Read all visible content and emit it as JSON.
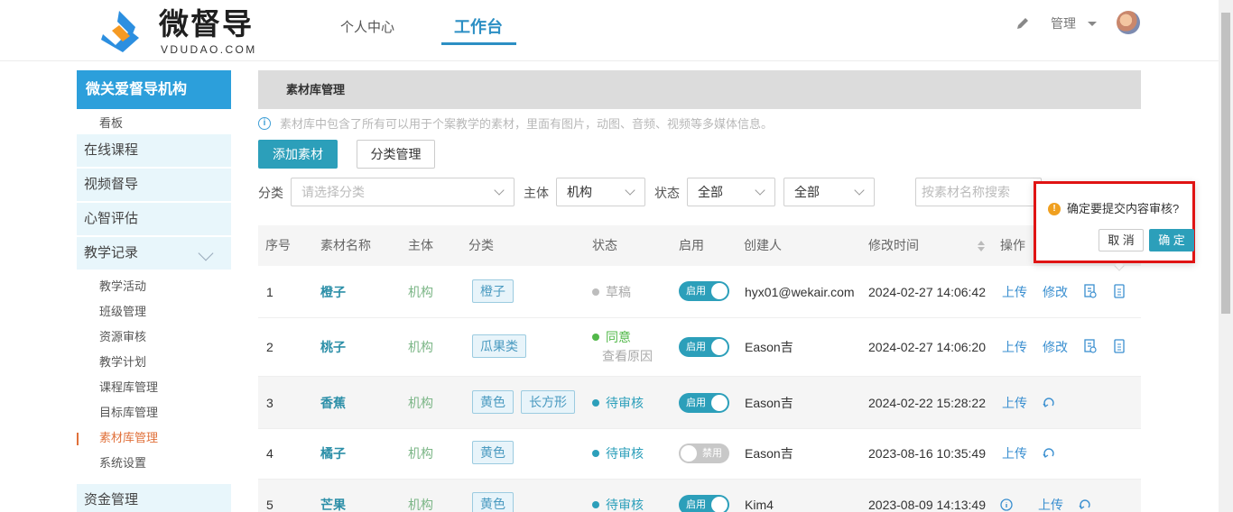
{
  "brand": {
    "name": "微督导",
    "sub": "VDUDAO.COM",
    "mark_color": "#2c8fe0",
    "accent_color": "#f59a23"
  },
  "nav": {
    "items": [
      "个人中心",
      "工作台"
    ],
    "active": "工作台"
  },
  "user": {
    "label": "管理",
    "edit_icon": "pencil-icon",
    "avatar": "avatar-image"
  },
  "sidebar": {
    "org": "微关爱督导机构",
    "kanban": "看板",
    "groups": [
      "在线课程",
      "视频督导",
      "心智评估",
      "教学记录",
      "资金管理"
    ],
    "sub_items": [
      "教学活动",
      "班级管理",
      "资源审核",
      "教学计划",
      "课程库管理",
      "目标库管理",
      "素材库管理",
      "系统设置"
    ],
    "active_item": "素材库管理"
  },
  "page": {
    "title": "素材库管理",
    "info": "素材库中包含了所有可以用于个案教学的素材，里面有图片，动图、音频、视频等多媒体信息。",
    "add_button": "添加素材",
    "category_button": "分类管理"
  },
  "filters": {
    "category_label": "分类",
    "category_placeholder": "请选择分类",
    "subject_label": "主体",
    "subject_value": "机构",
    "status_label": "状态",
    "status_value": "全部",
    "enabled_value": "全部",
    "search_placeholder": "按素材名称搜索"
  },
  "table": {
    "columns": [
      "序号",
      "素材名称",
      "主体",
      "分类",
      "状态",
      "启用",
      "创建人",
      "修改时间",
      "操作"
    ],
    "rows": [
      {
        "no": "1",
        "name": "橙子",
        "subject": "机构",
        "tags": [
          "橙子"
        ],
        "status": "草稿",
        "status_color": "#bdbdbd",
        "status_note": "",
        "enabled": "启用",
        "creator": "hyx01@wekair.com",
        "modified": "2024-02-27 14:06:42",
        "ops": [
          "上传",
          "修改"
        ]
      },
      {
        "no": "2",
        "name": "桃子",
        "subject": "机构",
        "tags": [
          "瓜果类"
        ],
        "status": "同意",
        "status_color": "#52b84a",
        "status_note": "查看原因",
        "enabled": "启用",
        "creator": "Eason吉",
        "modified": "2024-02-27 14:06:20",
        "ops": [
          "上传",
          "修改"
        ]
      },
      {
        "no": "3",
        "name": "香蕉",
        "subject": "机构",
        "tags": [
          "黄色",
          "长方形"
        ],
        "status": "待审核",
        "status_color": "#2c9fba",
        "status_note": "",
        "enabled": "启用",
        "creator": "Eason吉",
        "modified": "2024-02-22 15:28:22",
        "ops": [
          "上传"
        ]
      },
      {
        "no": "4",
        "name": "橘子",
        "subject": "机构",
        "tags": [
          "黄色"
        ],
        "status": "待审核",
        "status_color": "#2c9fba",
        "status_note": "",
        "enabled": "禁用",
        "creator": "Eason吉",
        "modified": "2023-08-16 10:35:49",
        "ops": [
          "上传"
        ]
      },
      {
        "no": "5",
        "name": "芒果",
        "subject": "机构",
        "tags": [
          "黄色"
        ],
        "status": "待审核",
        "status_color": "#2c9fba",
        "status_note": "",
        "enabled": "启用",
        "creator": "Kim4",
        "modified": "2023-08-09 14:13:49",
        "ops": [
          "上传"
        ]
      }
    ]
  },
  "popover": {
    "message": "确定要提交内容审核?",
    "cancel": "取 消",
    "confirm": "确 定"
  }
}
